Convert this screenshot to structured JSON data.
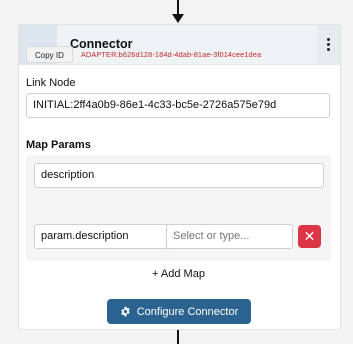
{
  "card": {
    "title": "Connector",
    "copy_button_label": "Copy ID",
    "adapter_id": "ADAPTER:b626d128-184d-4dab-81ae-3f014cee1dea",
    "link_node": {
      "label": "Link Node",
      "value": "INITIAL:2ff4a0b9-86e1-4c33-bc5e-2726a575e79d"
    },
    "map_params": {
      "label": "Map Params",
      "first_value": "description",
      "row": {
        "param_value": "param.description",
        "select_placeholder": "Select or type...",
        "delete_label": "✕"
      },
      "add_label": "+ Add Map"
    },
    "configure_label": "Configure Connector"
  },
  "icons": {
    "menu": "kebab-menu-icon",
    "configure": "gear-icon",
    "delete": "close-icon"
  },
  "colors": {
    "primary": "#2a6390",
    "danger": "#dc3545",
    "id_text": "#c62828"
  }
}
